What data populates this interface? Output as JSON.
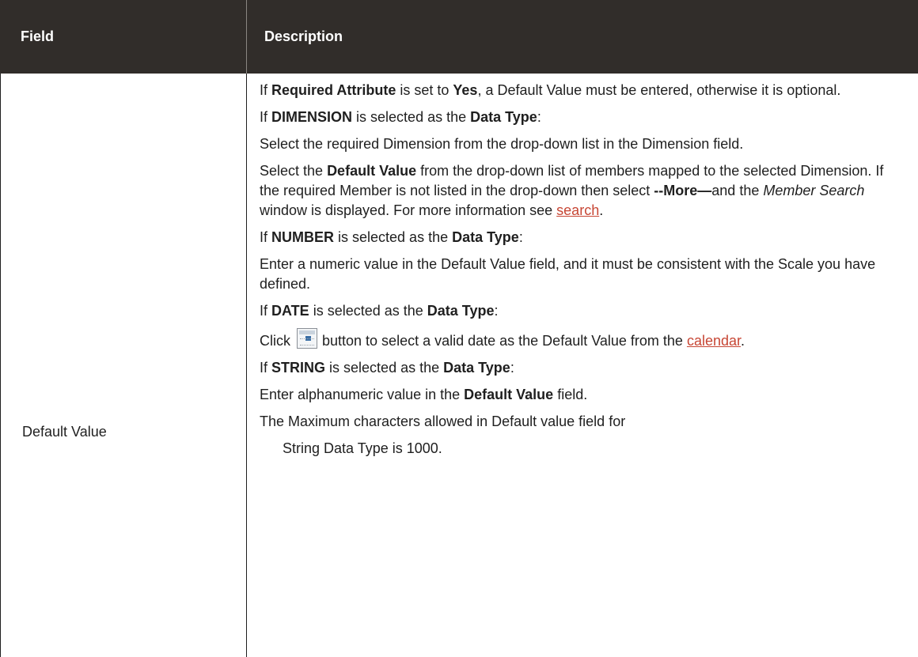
{
  "header": {
    "field": "Field",
    "description": "Description"
  },
  "row": {
    "field": "Default Value",
    "desc": {
      "p1": {
        "a": "If ",
        "b": "Required Attribute",
        "c": " is set to ",
        "d": "Yes",
        "e": ", a Default Value must be entered, otherwise it is optional."
      },
      "p2": {
        "a": "If ",
        "b": "DIMENSION",
        "c": " is selected as the ",
        "d": "Data Type",
        "e": ":"
      },
      "p3": "Select the required Dimension from the drop-down list in the Dimension field.",
      "p4": {
        "a": "Select the ",
        "b": "Default Value",
        "c": " from the drop-down list of members mapped to the selected Dimension. If the required Member is not listed in the drop-down then select ",
        "d": "--More—",
        "e": "and the ",
        "f": "Member Search",
        "g": " window is displayed. For more information see ",
        "link": "search",
        "h": "."
      },
      "p5": {
        "a": "If ",
        "b": "NUMBER",
        "c": " is selected as the ",
        "d": "Data Type",
        "e": ":"
      },
      "p6": "Enter a numeric value in the Default Value field, and it must be consistent with the Scale you have defined.",
      "p7": {
        "a": "If ",
        "b": "DATE",
        "c": " is selected as the ",
        "d": "Data Type",
        "e": ":"
      },
      "p8": {
        "a": "Click",
        "b": "button to select a valid date as the Default Value from the ",
        "link": "calendar",
        "c": ".",
        "icon": "calendar-icon"
      },
      "p9": {
        "a": "If ",
        "b": "STRING",
        "c": " is selected as the ",
        "d": "Data Type",
        "e": ":"
      },
      "p10": {
        "a": "Enter alphanumeric value in the ",
        "b": "Default Value",
        "c": " field."
      },
      "p11": "The Maximum characters allowed in Default value field for",
      "p12": "String Data Type is 1000."
    }
  },
  "colors": {
    "header_bg": "#312d2a",
    "header_text": "#ffffff",
    "link": "#c74634"
  }
}
